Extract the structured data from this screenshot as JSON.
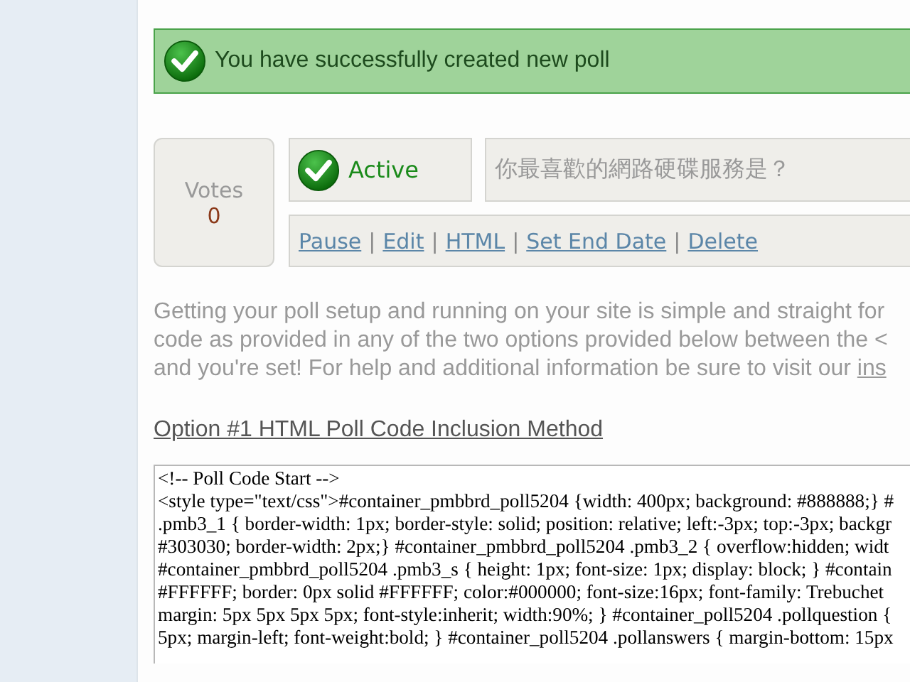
{
  "notice": {
    "text": "You have successfully created new poll"
  },
  "poll": {
    "votes_label": "Votes",
    "votes": "0",
    "status": "Active",
    "question": "你最喜歡的網路硬碟服務是？",
    "actions": [
      {
        "kind": "link",
        "text": "Pause"
      },
      {
        "kind": "separator",
        "text": "|"
      },
      {
        "kind": "link",
        "text": "Edit"
      },
      {
        "kind": "separator",
        "text": "|"
      },
      {
        "kind": "link",
        "text": "HTML"
      },
      {
        "kind": "separator",
        "text": "|"
      },
      {
        "kind": "link",
        "text": "Set End Date"
      },
      {
        "kind": "separator",
        "text": "|"
      },
      {
        "kind": "link",
        "text": "Delete"
      }
    ]
  },
  "intro": {
    "lines": [
      "Getting your poll setup and running on your site is simple and straight for",
      "code as provided in any of the two options provided below between the <",
      "and you're set! For help and additional information be sure to visit our "
    ],
    "link": "ins"
  },
  "option_heading": "Option #1 HTML Poll Code Inclusion Method",
  "code_lines": [
    "<!-- Poll Code Start -->",
    "<style type=\"text/css\">#container_pmbbrd_poll5204 {width: 400px; background: #888888;} #",
    ".pmb3_1 { border-width: 1px; border-style: solid; position: relative; left:-3px; top:-3px; backgr",
    "#303030; border-width: 2px;} #container_pmbbrd_poll5204 .pmb3_2 { overflow:hidden; widt",
    "#container_pmbbrd_poll5204 .pmb3_s { height: 1px; font-size: 1px; display: block; } #contain",
    "#FFFFFF; border: 0px solid #FFFFFF; color:#000000; font-size:16px; font-family: Trebuchet",
    "margin: 5px 5px 5px 5px; font-style:inherit; width:90%; } #container_poll5204 .pollquestion {",
    "5px; margin-left; font-weight:bold; } #container_poll5204 .pollanswers { margin-bottom: 15px"
  ]
}
